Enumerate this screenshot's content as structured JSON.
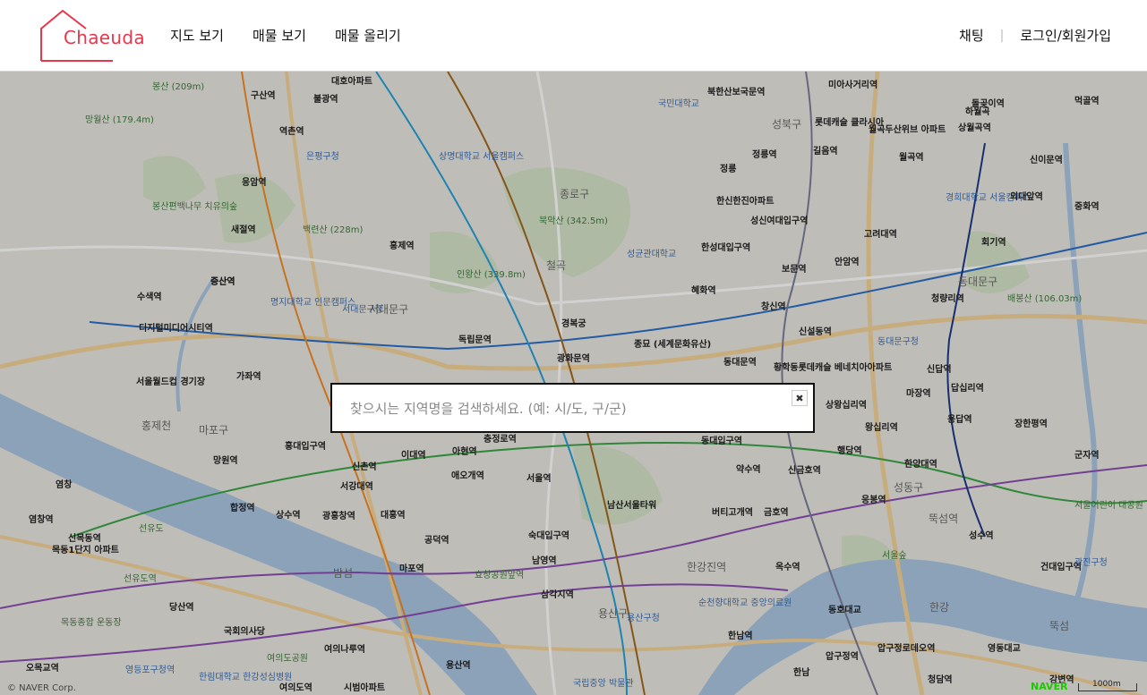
{
  "brand": {
    "logo_text": "Chaeuda",
    "accent": "#e8364a"
  },
  "nav": {
    "items": [
      "지도 보기",
      "매물 보기",
      "매물 올리기"
    ]
  },
  "right_nav": {
    "chat": "채팅",
    "separator": "|",
    "login": "로그인/회원가입"
  },
  "search": {
    "placeholder": "찾으시는 지역명을 검색하세요. (예: 시/도, 구/군)",
    "value": "",
    "close_icon": "close-icon"
  },
  "map": {
    "copyright": "© NAVER Corp.",
    "naver_logo": "NAVER",
    "scale_label": "1000m",
    "labels": [
      "봉산 (209m)",
      "망월산 (179.4m)",
      "구산역",
      "불광역",
      "대호아파트",
      "북한산보국문역",
      "국민대학교",
      "미아사거리역",
      "역촌역",
      "은평구청",
      "상명대학교 서울캠퍼스",
      "성북구",
      "롯데캐슬 클라시아",
      "월곡두산위브 아파트",
      "돌곶이역",
      "상월곡역",
      "하월곡",
      "먹골역",
      "증산역",
      "응암역",
      "정릉",
      "정릉역",
      "길음역",
      "월곡역",
      "신이문역",
      "종로구",
      "북악산 (342.5m)",
      "한신한진아파트",
      "경희대학교 서울캠퍼스",
      "외대앞역",
      "중화역",
      "봉산편백나무 치유의숲",
      "백련산 (228m)",
      "새절역",
      "성신여대입구역",
      "고려대역",
      "회기역",
      "홍제역",
      "성균관대학교",
      "한성대입구역",
      "안암역",
      "수색역",
      "증산역",
      "인왕산 (339.8m)",
      "명지대학교 인문캠퍼스",
      "서대문구청",
      "서대문구",
      "철곡",
      "혜화역",
      "보문역",
      "청량리역",
      "동대문구",
      "배봉산 (106.03m)",
      "디지털미디어시티역",
      "경복궁",
      "종묘 (세계문화유산)",
      "창신역",
      "신설동역",
      "독립문역",
      "광화문역",
      "동대문역",
      "동대문구청",
      "서울월드컵 경기장",
      "가좌역",
      "황학동롯데캐슬 베네치아아파트",
      "상왕십리역",
      "신답역",
      "답십리역",
      "마장역",
      "왕십리역",
      "용답역",
      "장한평역",
      "군자역",
      "홍제천",
      "마포구",
      "홍대입구역",
      "이대역",
      "아현역",
      "충정로역",
      "동대입구역",
      "약수역",
      "행당역",
      "신금호역",
      "한양대역",
      "성동구",
      "뚝섬역",
      "성수역",
      "서울어린이 대공원",
      "망원역",
      "신촌역",
      "애오개역",
      "서울역",
      "남산서울타워",
      "버티고개역",
      "금호역",
      "응봉역",
      "서강대역",
      "합정역",
      "상수역",
      "광흥창역",
      "대흥역",
      "공덕역",
      "숙대입구역",
      "남영역",
      "한강진역",
      "옥수역",
      "서울숲",
      "건대입구역",
      "광진구청",
      "염창역",
      "신목동역",
      "선유도",
      "목동1단지 아파트",
      "선유도역",
      "당산역",
      "밤섬",
      "마포역",
      "효창공원앞역",
      "삼각지역",
      "용산구",
      "용산구청",
      "순천향대학교 중앙의료원",
      "한남역",
      "동호대교",
      "압구정역",
      "압구정로데오역",
      "영동대교",
      "뚝섬",
      "한강",
      "목동종합 운동장",
      "국회의사당",
      "여의도공원",
      "여의나루역",
      "영등포구청역",
      "오목교역",
      "한림대학교 한강성심병원",
      "여의도역",
      "시범아파트",
      "용산역",
      "국립중앙 박물관",
      "한남",
      "청담역",
      "강변역",
      "염창"
    ]
  }
}
